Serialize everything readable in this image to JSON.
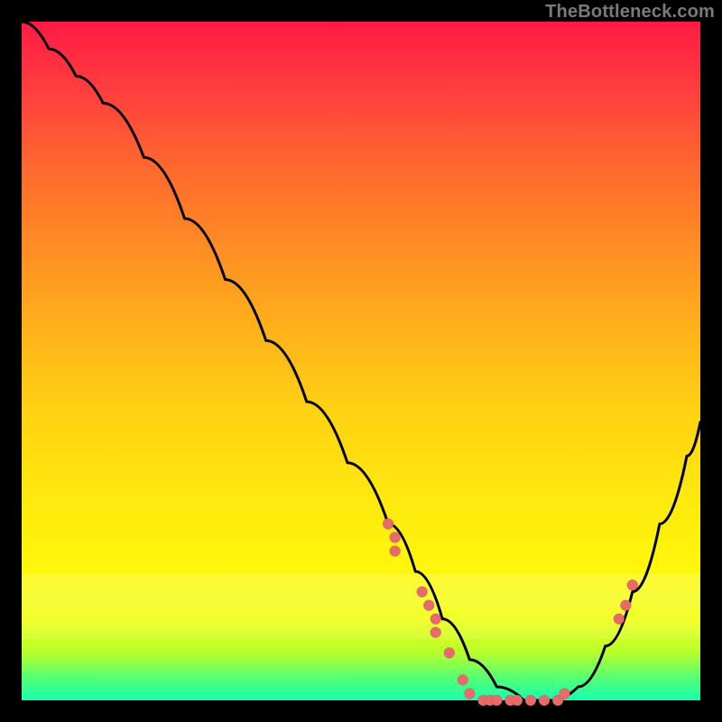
{
  "watermark": "TheBottleneck.com",
  "chart_data": {
    "type": "line",
    "title": "",
    "xlabel": "",
    "ylabel": "",
    "xlim": [
      0,
      100
    ],
    "ylim": [
      0,
      100
    ],
    "series": [
      {
        "name": "curve",
        "x": [
          0,
          4,
          8,
          12,
          18,
          24,
          30,
          36,
          42,
          48,
          54,
          58,
          62,
          66,
          70,
          74,
          78,
          82,
          86,
          90,
          94,
          98,
          100
        ],
        "y": [
          100,
          96,
          92,
          88,
          80,
          71,
          62,
          53,
          44,
          35,
          26,
          19,
          12,
          6,
          2,
          0,
          0,
          2,
          8,
          16,
          26,
          36,
          41
        ]
      }
    ],
    "markers": [
      {
        "x": 54,
        "y": 26
      },
      {
        "x": 55,
        "y": 24
      },
      {
        "x": 55,
        "y": 22
      },
      {
        "x": 59,
        "y": 16
      },
      {
        "x": 60,
        "y": 14
      },
      {
        "x": 61,
        "y": 12
      },
      {
        "x": 61,
        "y": 10
      },
      {
        "x": 63,
        "y": 7
      },
      {
        "x": 65,
        "y": 3
      },
      {
        "x": 66,
        "y": 1
      },
      {
        "x": 68,
        "y": 0
      },
      {
        "x": 69,
        "y": 0
      },
      {
        "x": 70,
        "y": 0
      },
      {
        "x": 72,
        "y": 0
      },
      {
        "x": 73,
        "y": 0
      },
      {
        "x": 75,
        "y": 0
      },
      {
        "x": 77,
        "y": 0
      },
      {
        "x": 79,
        "y": 0
      },
      {
        "x": 80,
        "y": 1
      },
      {
        "x": 88,
        "y": 12
      },
      {
        "x": 89,
        "y": 14
      },
      {
        "x": 90,
        "y": 17
      }
    ],
    "annotations": []
  }
}
